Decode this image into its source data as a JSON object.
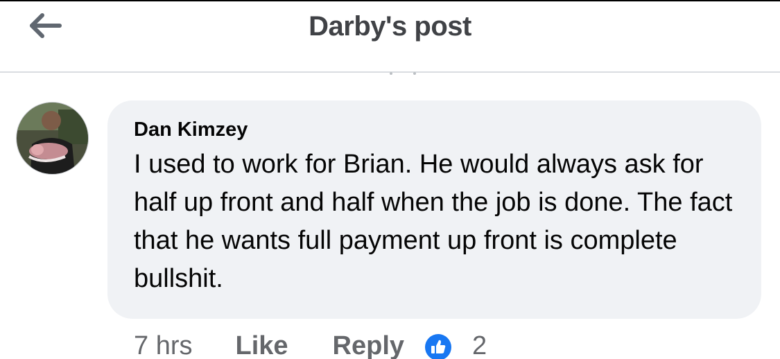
{
  "header": {
    "title": "Darby's post",
    "back_icon": "left-arrow-icon"
  },
  "comment": {
    "author": "Dan Kimzey",
    "text": "I used to work for Brian. He would always ask for half up front and half when the job is done. The fact that he wants full payment up front is complete bullshit.",
    "avatar_icon": "user-avatar",
    "timestamp": "7 hrs",
    "like_label": "Like",
    "reply_label": "Reply",
    "reaction_icon": "thumbs-up-icon",
    "reaction_count": "2"
  },
  "colors": {
    "bubble_bg": "#f0f2f5",
    "meta_text": "#65676b",
    "like_blue": "#1877f2",
    "title_text": "#404246"
  }
}
